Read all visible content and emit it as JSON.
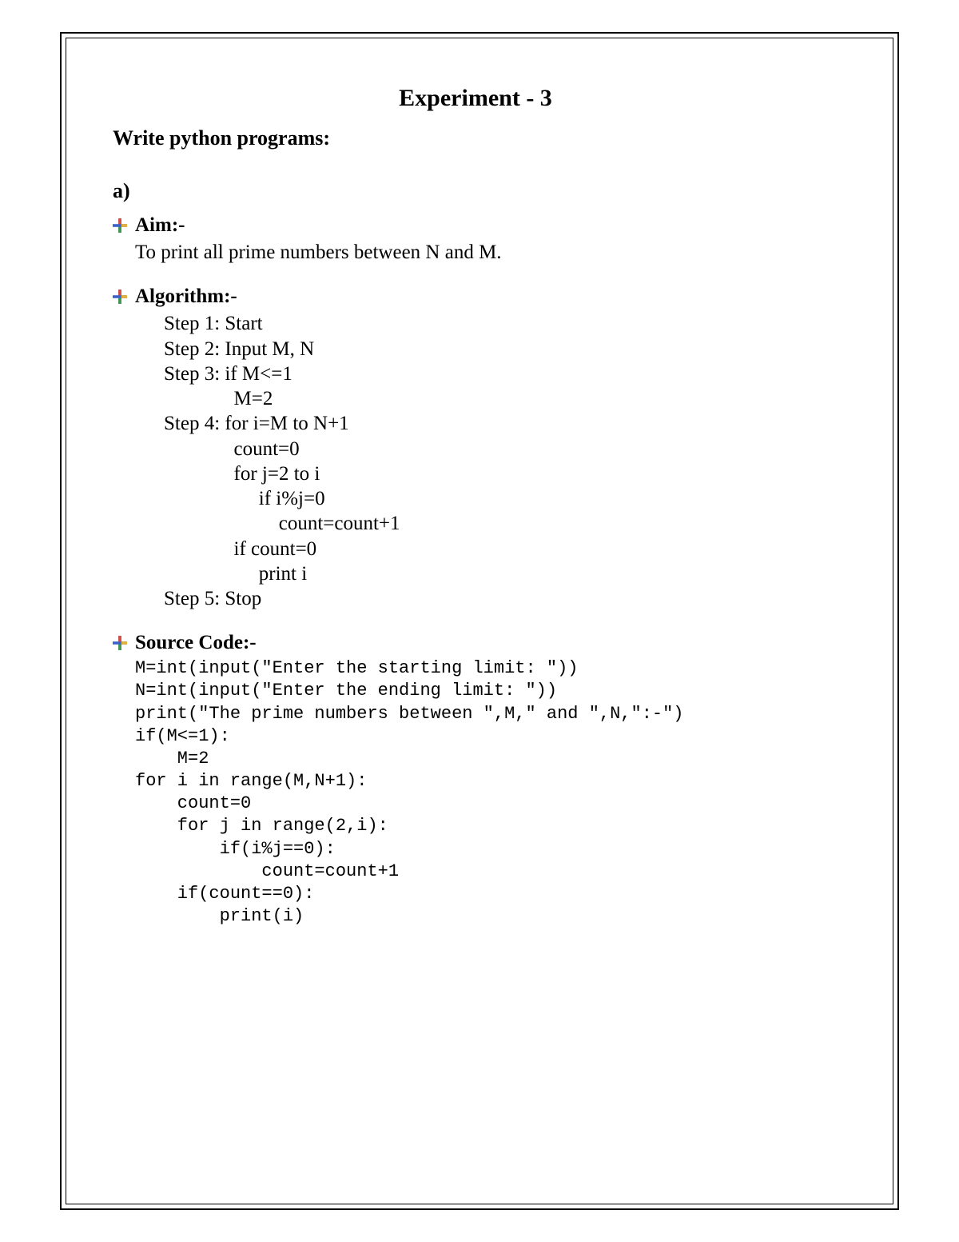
{
  "title": "Experiment - 3",
  "subtitle": "Write python programs:",
  "part_label": "a)",
  "sections": {
    "aim": {
      "heading": "Aim:-",
      "text": "To print all prime numbers between N and M."
    },
    "algorithm": {
      "heading": "Algorithm:-",
      "steps": "Step 1: Start\nStep 2: Input M, N\nStep 3: if M<=1\n              M=2\nStep 4: for i=M to N+1\n              count=0\n              for j=2 to i\n                   if i%j=0\n                       count=count+1\n              if count=0\n                   print i\nStep 5: Stop"
    },
    "source": {
      "heading": "Source Code:-",
      "code": "M=int(input(\"Enter the starting limit: \"))\nN=int(input(\"Enter the ending limit: \"))\nprint(\"The prime numbers between \",M,\" and \",N,\":-\")\nif(M<=1):\n    M=2\nfor i in range(M,N+1):\n    count=0\n    for j in range(2,i):\n        if(i%j==0):\n            count=count+1\n    if(count==0):\n        print(i)"
    }
  }
}
